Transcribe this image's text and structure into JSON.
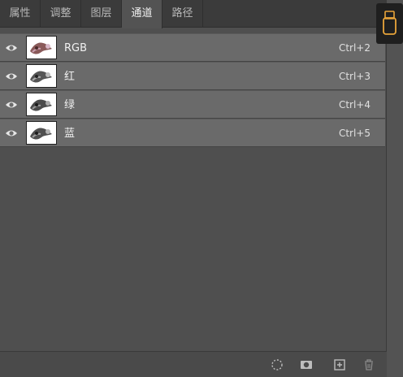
{
  "tabs": [
    {
      "label": "属性"
    },
    {
      "label": "调整"
    },
    {
      "label": "图层"
    },
    {
      "label": "通道",
      "active": true
    },
    {
      "label": "路径"
    }
  ],
  "channels": [
    {
      "name": "RGB",
      "shortcut": "Ctrl+2",
      "visible": true
    },
    {
      "name": "红",
      "shortcut": "Ctrl+3",
      "visible": true
    },
    {
      "name": "绿",
      "shortcut": "Ctrl+4",
      "visible": true
    },
    {
      "name": "蓝",
      "shortcut": "Ctrl+5",
      "visible": true
    }
  ],
  "footer_icons": [
    "load-selection-icon",
    "save-selection-mask-icon",
    "new-channel-icon",
    "delete-channel-icon"
  ],
  "colors": {
    "accent": "#e8a43a",
    "row_bg": "#6a6a6a"
  }
}
